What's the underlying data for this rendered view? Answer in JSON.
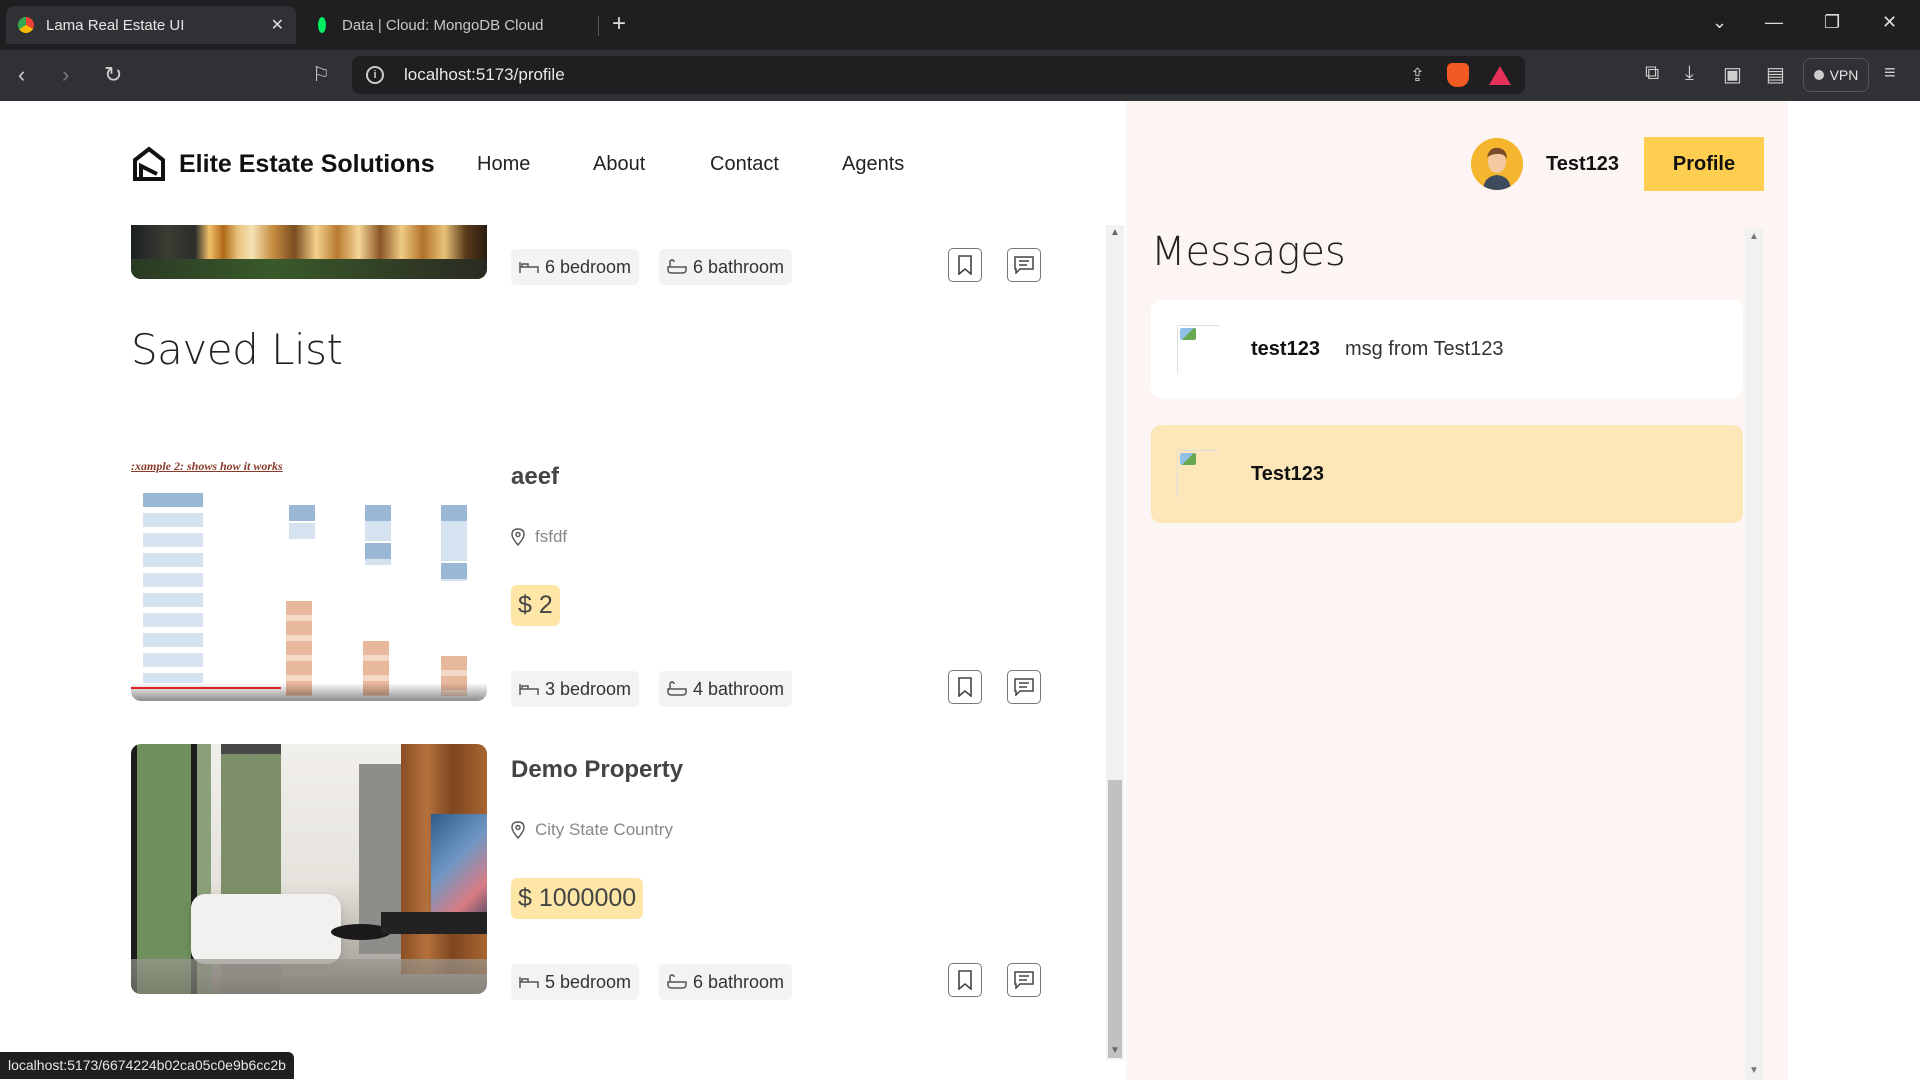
{
  "browser": {
    "tabs": [
      {
        "title": "Lama Real Estate UI",
        "close": "✕"
      },
      {
        "title": "Data | Cloud: MongoDB Cloud"
      }
    ],
    "new_tab": "+",
    "url": "localhost:5173/profile",
    "vpn_label": "VPN",
    "status_url": "localhost:5173/6674224b02ca05c0e9b6cc2b"
  },
  "navbar": {
    "brand": "Elite Estate Solutions",
    "links": [
      "Home",
      "About",
      "Contact",
      "Agents"
    ],
    "username": "Test123",
    "profile_button": "Profile"
  },
  "top_card": {
    "bedrooms": "6 bedroom",
    "bathrooms": "6 bathroom"
  },
  "saved_list": {
    "title": "Saved List",
    "items": [
      {
        "title": "aeef",
        "address": "fsfdf",
        "price": "$ 2",
        "bedrooms": "3 bedroom",
        "bathrooms": "4 bathroom",
        "thumbnail_text": ":xample 2: shows how it works"
      },
      {
        "title": "Demo Property",
        "address": "City State Country",
        "price": "$ 1000000",
        "bedrooms": "5 bedroom",
        "bathrooms": "6 bathroom"
      }
    ]
  },
  "messages": {
    "title": "Messages",
    "items": [
      {
        "user": "test123",
        "text": "msg from Test123",
        "highlight": false
      },
      {
        "user": "Test123",
        "text": "",
        "highlight": true
      }
    ]
  },
  "colors": {
    "accent": "#fece51",
    "price_bg": "#fde6a6",
    "panel_bg": "#fcf5f3",
    "unread_bg": "#fde6b8"
  }
}
